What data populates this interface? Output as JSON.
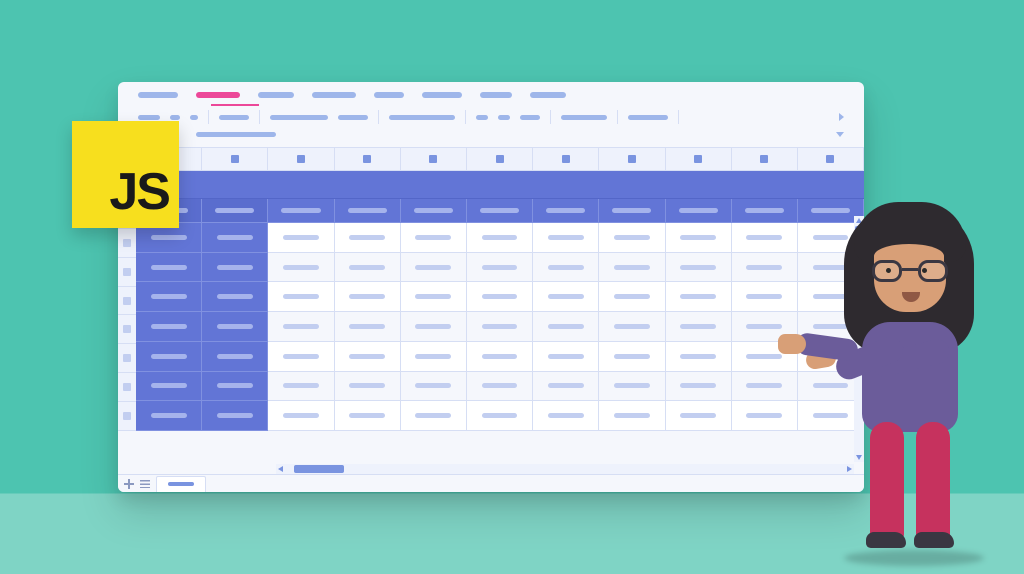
{
  "badge": {
    "label": "JS"
  },
  "colors": {
    "background_top": "#4dc4b0",
    "background_bottom": "#7fd4c5",
    "js_yellow": "#f7df1e",
    "accent_pink": "#ec4899",
    "ui_blue_light": "#9eb6ea",
    "ui_blue_mid": "#7a94e0",
    "frozen_blue": "#6275d6",
    "window_bg": "#f5f7fc",
    "grid_line": "#d6def4"
  },
  "spreadsheet": {
    "tabs": {
      "count": 8,
      "active_index": 1
    },
    "column_count": 11,
    "frozen_columns": 2,
    "data_row_count": 7,
    "has_vertical_scrollbar": true,
    "has_horizontal_scrollbar": true,
    "sheet_tab_count": 1
  },
  "character": {
    "description": "3d-cartoon-woman-with-glasses-presenting",
    "shirt_color": "#6b5c9a",
    "pants_color": "#c6325e",
    "hair_color": "#2e2a2f",
    "skin_color": "#d89f77"
  }
}
